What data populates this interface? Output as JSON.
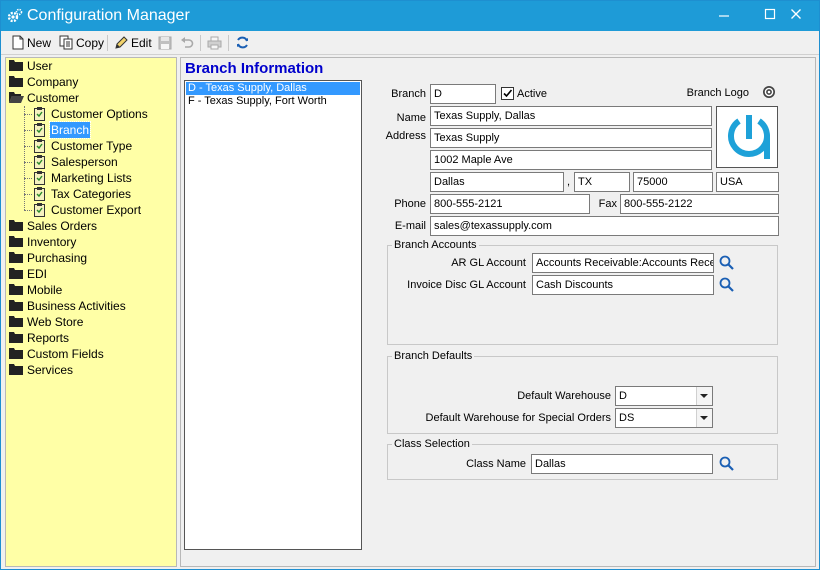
{
  "window": {
    "title": "Configuration Manager"
  },
  "toolbar": {
    "new_label": "New",
    "copy_label": "Copy",
    "edit_label": "Edit"
  },
  "tree": {
    "user": "User",
    "company": "Company",
    "customer": "Customer",
    "customer_children": [
      "Customer Options",
      "Branch",
      "Customer Type",
      "Salesperson",
      "Marketing Lists",
      "Tax Categories",
      "Customer Export"
    ],
    "rest": [
      "Sales Orders",
      "Inventory",
      "Purchasing",
      "EDI",
      "Mobile",
      "Business Activities",
      "Web Store",
      "Reports",
      "Custom Fields",
      "Services"
    ]
  },
  "section": {
    "title": "Branch Information"
  },
  "branch_list": [
    "D - Texas Supply, Dallas",
    "F - Texas Supply, Fort Worth"
  ],
  "form": {
    "branch_label": "Branch",
    "branch_value": "D",
    "active_label": "Active",
    "logo_label": "Branch Logo",
    "name_label": "Name",
    "name_value": "Texas Supply, Dallas",
    "address_label": "Address",
    "address1": "Texas Supply",
    "address2": "1002 Maple Ave",
    "city": "Dallas",
    "comma": ",",
    "state": "TX",
    "zip": "75000",
    "country": "USA",
    "phone_label": "Phone",
    "phone_value": "800-555-2121",
    "fax_label": "Fax",
    "fax_value": "800-555-2122",
    "email_label": "E-mail",
    "email_value": "sales@texassupply.com"
  },
  "accounts": {
    "title": "Branch Accounts",
    "ar_label": "AR GL Account",
    "ar_value": "Accounts Receivable:Accounts Recei",
    "disc_label": "Invoice Disc GL Account",
    "disc_value": "Cash Discounts"
  },
  "defaults": {
    "title": "Branch Defaults",
    "wh_label": "Default Warehouse",
    "wh_value": "D",
    "wh_special_label": "Default Warehouse for Special Orders",
    "wh_special_value": "DS"
  },
  "class": {
    "title": "Class Selection",
    "label": "Class Name",
    "value": "Dallas"
  },
  "colors": {
    "title_bar": "#1e9bd7",
    "tree_bg": "#ffffa6",
    "selection": "#3399ff",
    "section_title": "#0000cc",
    "logo": "#1ea1d8"
  }
}
